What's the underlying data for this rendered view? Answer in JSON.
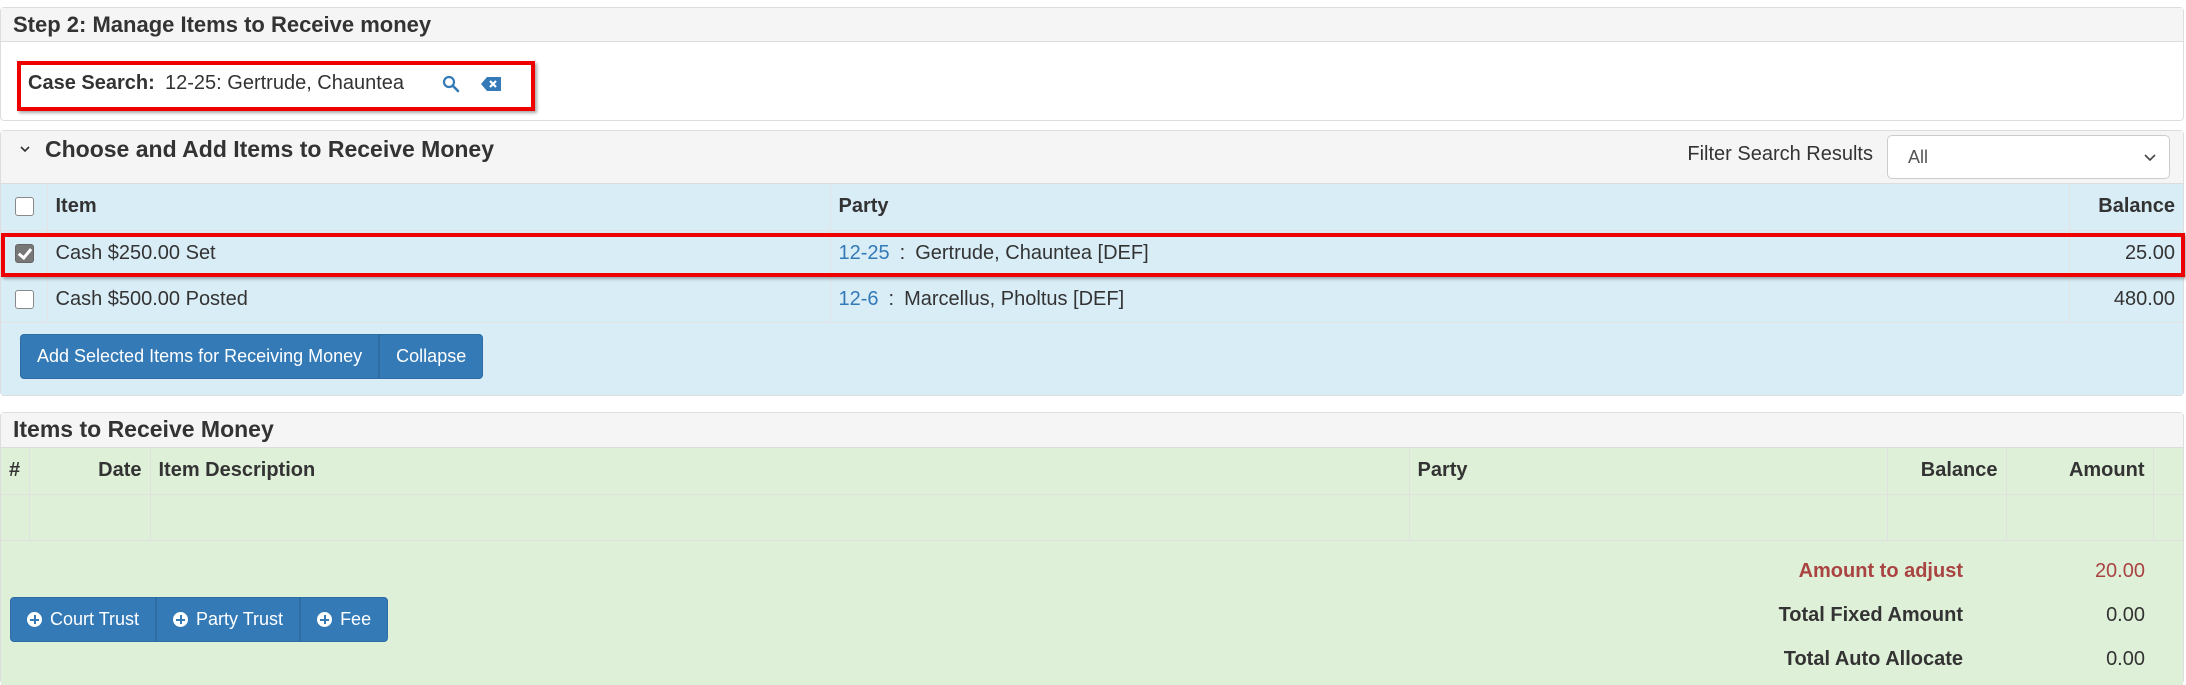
{
  "step": {
    "title": "Step 2: Manage Items to Receive money",
    "case_search_label": "Case Search:",
    "case_search_value": "12-25: Gertrude, Chauntea"
  },
  "choose": {
    "title": "Choose and Add Items to Receive Money",
    "filter_label": "Filter Search Results",
    "filter_value": "All",
    "columns": [
      "Item",
      "Party",
      "Balance"
    ],
    "rows": [
      {
        "checked": true,
        "item": "Cash $250.00 Set",
        "case": "12-25",
        "sep": ":",
        "party": "Gertrude, Chauntea [DEF]",
        "balance": "25.00"
      },
      {
        "checked": false,
        "item": "Cash $500.00 Posted",
        "case": "12-6",
        "sep": ":",
        "party": "Marcellus, Pholtus [DEF]",
        "balance": "480.00"
      }
    ],
    "add_button": "Add Selected Items for Receiving Money",
    "collapse_button": "Collapse"
  },
  "items": {
    "title": "Items to Receive Money",
    "columns": [
      "#",
      "Date",
      "Item Description",
      "Party",
      "Balance",
      "Amount"
    ],
    "totals": [
      {
        "label": "Amount to adjust",
        "value": "20.00",
        "highlight": true
      },
      {
        "label": "Total Fixed Amount",
        "value": "0.00"
      },
      {
        "label": "Total Auto Allocate",
        "value": "0.00"
      }
    ],
    "buttons": [
      "Court Trust",
      "Party Trust",
      "Fee"
    ]
  },
  "colors": {
    "accent": "#337ab7",
    "info_bg": "#d9edf7",
    "success_bg": "#dff0d8",
    "danger_text": "#a94442",
    "highlight_border": "#ee0000"
  }
}
